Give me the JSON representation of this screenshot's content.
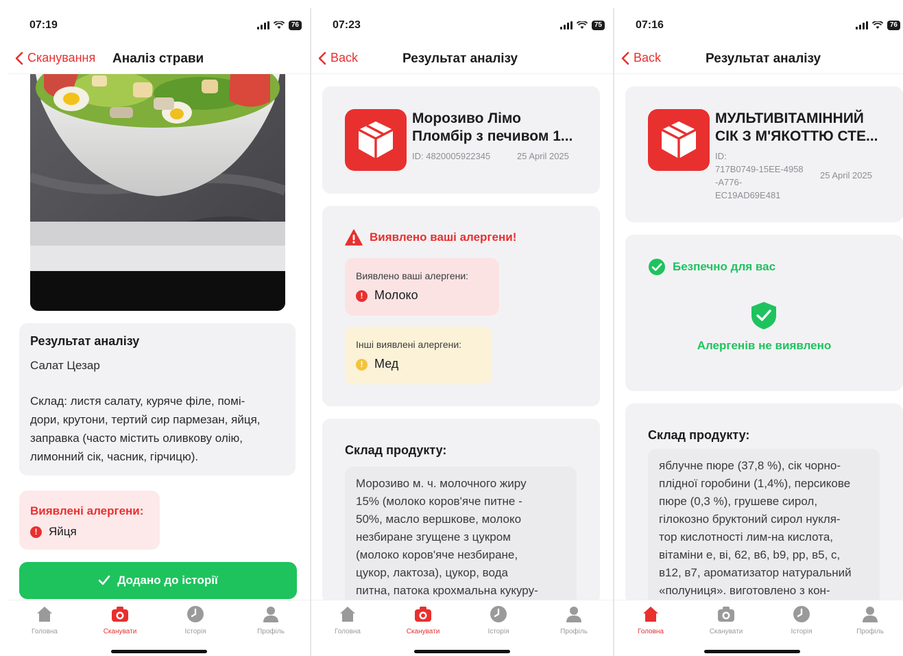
{
  "phone1": {
    "status": {
      "time": "07:19",
      "battery": "76"
    },
    "nav": {
      "back_label": "Сканування",
      "title": "Аналіз страви"
    },
    "result_card": {
      "heading": "Результат аналізу",
      "dish": "Салат Цезар",
      "composition_lines": [
        "Склад: листя салату, куряче філе, помі-",
        "дори, крутони, тертий сир пармезан, яйця,",
        "заправка (часто містить оливкову олію,",
        "лимонний сік, часник, гірчицю)."
      ]
    },
    "allergens": {
      "title": "Виявлені алергени:",
      "item": "Яйця"
    },
    "added_button": "Додано до історії"
  },
  "phone2": {
    "status": {
      "time": "07:23",
      "battery": "75"
    },
    "nav": {
      "back_label": "Back",
      "title": "Результат аналізу"
    },
    "product": {
      "name_line1": "Морозиво Лімо",
      "name_line2": "Пломбір з печивом 1...",
      "id": "ID: 4820005922345",
      "date": "25 April 2025"
    },
    "warning": {
      "title": "Виявлено ваші алергени!",
      "yours_label": "Виявлено ваші алергени:",
      "yours_item": "Молоко",
      "others_label": "Інші виявлені алергени:",
      "others_item": "Мед"
    },
    "composition": {
      "title": "Склад продукту:",
      "lines": [
        "Морозиво м. ч. молочного жиру",
        "15% (молоко коров'яче питне -",
        "50%, масло вершкове, молоко",
        "незбиране згущене з цукром",
        "(молоко коров'яче незбиране,",
        "цукор, лактоза), цукор, вода",
        "питна, патока крохмальна кукуру-"
      ]
    }
  },
  "phone3": {
    "status": {
      "time": "07:16",
      "battery": "76"
    },
    "nav": {
      "back_label": "Back",
      "title": "Результат аналізу"
    },
    "product": {
      "name_line1": "МУЛЬТИВІТАМІННИЙ",
      "name_line2": "СІК З М'ЯКОТТЮ СТЕ...",
      "id_label": "ID:",
      "id_line1": "717B0749-15EE-4958",
      "id_line2": "-A776-",
      "id_line3": "EC19AD69E481",
      "date": "25 April 2025"
    },
    "safe": {
      "title": "Безпечно для вас",
      "message": "Алергенів не виявлено"
    },
    "composition": {
      "title": "Склад продукту:",
      "lines": [
        "яблучне пюре (37,8 %), сік чорно-",
        "плідної горобини (1,4%), персикове",
        "пюре (0,3 %), грушеве сирол,",
        "гілокозно бруктоний сирол нукля-",
        "тор кислотності лим-на кислота,",
        "вітаміни е, ві, 62, в6, b9, pp, в5, с,",
        "в12, в7, ароматизатор натуральний",
        "«полуниця». виготовлено з кон-"
      ]
    }
  },
  "tabs": [
    "Головна",
    "Сканувати",
    "Історія",
    "Профіль"
  ],
  "colors": {
    "accent_red": "#e8302f",
    "success_green": "#1ec35e",
    "warning_yellow": "#f5c33b",
    "card_bg": "#f2f2f4"
  },
  "icons": [
    "chevron-left-icon",
    "home-icon",
    "camera-icon",
    "clock-icon",
    "person-icon",
    "box-icon",
    "warning-triangle-icon",
    "check-circle-icon",
    "shield-check-icon",
    "exclamation-dot-icon",
    "checkmark-icon"
  ]
}
